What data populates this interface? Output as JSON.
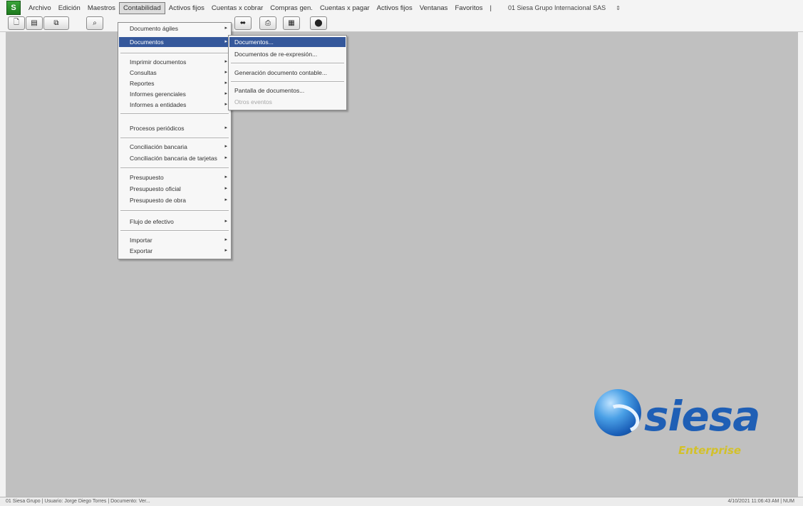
{
  "menubar": {
    "logo": "S",
    "items": [
      {
        "label": "Archivo"
      },
      {
        "label": "Edición"
      },
      {
        "label": "Maestros"
      },
      {
        "label": "Contabilidad"
      },
      {
        "label": "Activos fijos"
      },
      {
        "label": "Cuentas x cobrar"
      },
      {
        "label": "Compras gen."
      },
      {
        "label": "Cuentas x pagar"
      },
      {
        "label": "Activos fijos"
      },
      {
        "label": "Ventanas"
      },
      {
        "label": "Favoritos"
      },
      {
        "label": "|"
      }
    ],
    "company": "01 Siesa Grupo Internacional SAS",
    "company_arrow": "⇕"
  },
  "toolbar": {
    "buttons": [
      "🗋",
      "▤",
      "⧉",
      "⌕",
      "⬌",
      "⎙",
      "▦",
      "⬤"
    ]
  },
  "contabilidad_menu": {
    "items": [
      {
        "label": "Documento ágiles",
        "arrow": "▸"
      },
      {
        "label": "Documentos",
        "arrow": "▸"
      },
      {
        "label": "Imprimir documentos",
        "arrow": "▸"
      },
      {
        "label": "Consultas",
        "arrow": "▸"
      },
      {
        "label": "Reportes",
        "arrow": "▸"
      },
      {
        "label": "Informes gerenciales",
        "arrow": "▸"
      },
      {
        "label": "Informes a entidades",
        "arrow": "▸"
      },
      {
        "label": "Procesos periódicos",
        "arrow": "▸"
      },
      {
        "label": "Conciliación bancaria",
        "arrow": "▸"
      },
      {
        "label": "Conciliación bancaria de tarjetas",
        "arrow": "▸"
      },
      {
        "label": "Presupuesto",
        "arrow": "▸"
      },
      {
        "label": "Presupuesto oficial",
        "arrow": "▸"
      },
      {
        "label": "Presupuesto de obra",
        "arrow": "▸"
      },
      {
        "label": "Flujo de efectivo",
        "arrow": "▸"
      },
      {
        "label": "Importar",
        "arrow": "▸"
      },
      {
        "label": "Exportar",
        "arrow": "▸"
      }
    ]
  },
  "documentos_submenu": {
    "items": [
      {
        "label": "Documentos..."
      },
      {
        "label": "Documentos de re-expresión..."
      },
      {
        "label": "Generación documento contable..."
      },
      {
        "label": "Pantalla de documentos..."
      },
      {
        "label": "Otros eventos"
      }
    ]
  },
  "logo": {
    "word": "siesa",
    "sub": "Enterprise",
    "colors": {
      "blue": "#1f5fb5",
      "yellow": "#d3c12a"
    }
  },
  "statusbar": {
    "left": "01 Siesa Grupo | Usuario: Jorge Diego Torres | Documento: Ver...",
    "right": "4/10/2021  11:06:43 AM  |  NUM"
  },
  "colors": {
    "workspace": "#c0c0c0",
    "menu_highlight": "#35589b"
  }
}
